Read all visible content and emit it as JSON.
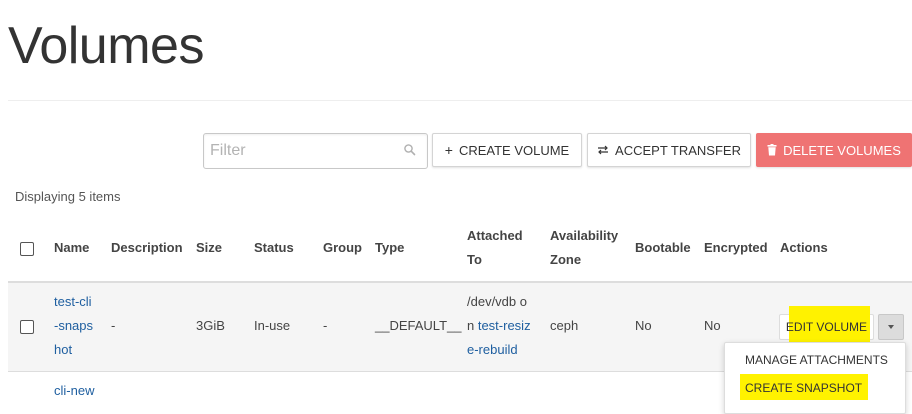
{
  "page": {
    "title": "Volumes"
  },
  "toolbar": {
    "filter_placeholder": "Filter",
    "create_label": "CREATE VOLUME",
    "accept_label": "ACCEPT TRANSFER",
    "delete_label": "DELETE VOLUMES"
  },
  "table": {
    "count_text": "Displaying 5 items",
    "headers": {
      "name": "Name",
      "description": "Description",
      "size": "Size",
      "status": "Status",
      "group": "Group",
      "type": "Type",
      "attached_to_1": "Attached",
      "attached_to_2": "To",
      "az_1": "Availability",
      "az_2": "Zone",
      "bootable": "Bootable",
      "encrypted": "Encrypted",
      "actions": "Actions"
    },
    "rows": [
      {
        "name_lines": [
          "test-cli",
          "-snaps",
          "hot"
        ],
        "description": "-",
        "size": "3GiB",
        "status": "In-use",
        "group": "-",
        "type": "__DEFAULT__",
        "attached_line1_path": "/dev/vdb o",
        "attached_line2_prefix": "n ",
        "attached_line2_link": "test-resiz",
        "attached_line3_link": "e-rebuild",
        "availability_zone": "ceph",
        "bootable": "No",
        "encrypted": "No",
        "action_label": "EDIT VOLUME"
      },
      {
        "name_lines": [
          "cli-new"
        ]
      }
    ]
  },
  "action_menu": {
    "items": [
      "MANAGE ATTACHMENTS",
      "CREATE SNAPSHOT"
    ]
  },
  "colors": {
    "danger": "#ef7373",
    "link": "#1f5fa0",
    "highlight": "#fff200"
  }
}
